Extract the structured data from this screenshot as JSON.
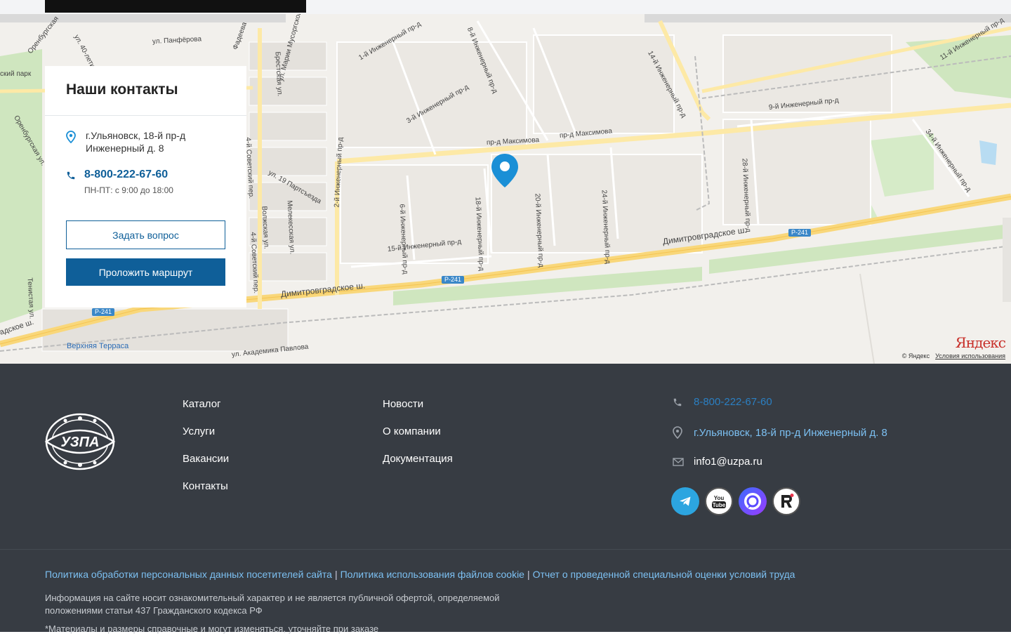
{
  "contacts_card": {
    "title": "Наши контакты",
    "address": "г.Ульяновск, 18-й пр-д Инженерный д. 8",
    "phone": "8-800-222-67-60",
    "hours": "ПН-ПТ: с 9:00 до 18:00",
    "ask_button": "Задать вопрос",
    "route_button": "Проложить маршрут"
  },
  "map": {
    "labels": {
      "l1": "1-й Инженерный пр-д",
      "l2": "8-й Инженерный пр-д",
      "l3": "14-й Инженерный пр-д",
      "l4": "11-й Инженерный пр-д",
      "l5": "3-й Инженерный пр-д",
      "l6": "пр-д Максимова",
      "l7": "пр-д Максимова",
      "l8": "9-й Инженерный пр-д",
      "l9": "18-й Инженерный пр-д",
      "l10": "20-й Инженерный пр-д",
      "l11": "24-й Инженерный пр-д",
      "l12": "28-й Инженерный пр-д",
      "l13": "34-й Инженерный пр-д",
      "l14": "6-й Инженерный пр-д",
      "l15": "15-й Инженерный пр-д",
      "l16": "Димитровградское ш.",
      "l17": "Димитровградское ш.",
      "l18": "ул. Панфёрова",
      "l19": "ул. 40-летия",
      "l20": "ул. 19 Партсъезда",
      "l21": "Брестская ул.",
      "l22": "ул. Марии Мусоргской",
      "l23": "4-й Советский пер.",
      "l24": "Волжская ул.",
      "l25": "Мелекесская ул.",
      "l26": "ул. Академика Павлова",
      "l27": "Оренбургская ул.",
      "l28": "Тенистая ул.",
      "l29": "2-й Инженерный пр-д",
      "l30": "Оренбургская",
      "l31": "адское ш.",
      "l32": "Фадеева",
      "l33": "4-й Советский пер.",
      "l34": "ский парк"
    },
    "badges": [
      "Р-241",
      "Р-241",
      "Р-241"
    ],
    "place_terrace": "Верхняя Терраса",
    "logo": "Яндекс",
    "copyright": "© Яндекс",
    "terms": "Условия использования"
  },
  "footer": {
    "nav_col1": [
      "Каталог",
      "Услуги",
      "Вакансии",
      "Контакты"
    ],
    "nav_col2": [
      "Новости",
      "О компании",
      "Документация"
    ],
    "phone": "8-800-222-67-60",
    "address": "г.Ульяновск, 18-й пр-д Инженерный д. 8",
    "email": "info1@uzpa.ru",
    "logo_text": "УЗПА",
    "policies": [
      "Политика обработки персональных данных посетителей сайта",
      "Политика использования файлов cookie",
      "Отчет о проведенной специальной оценки условий труда"
    ],
    "disclaimer": "Информация на сайте носит ознакомительный характер и не является публичной офертой, определяемой положениями статьи 437 Гражданского кодекса РФ",
    "note": "*Материалы и размеры справочные и могут изменяться, уточняйте при заказе"
  },
  "colors": {
    "primary": "#0f5f99",
    "footer_bg": "#373c43",
    "link": "#7cc0f2",
    "telegram": "#2ca5e0"
  }
}
